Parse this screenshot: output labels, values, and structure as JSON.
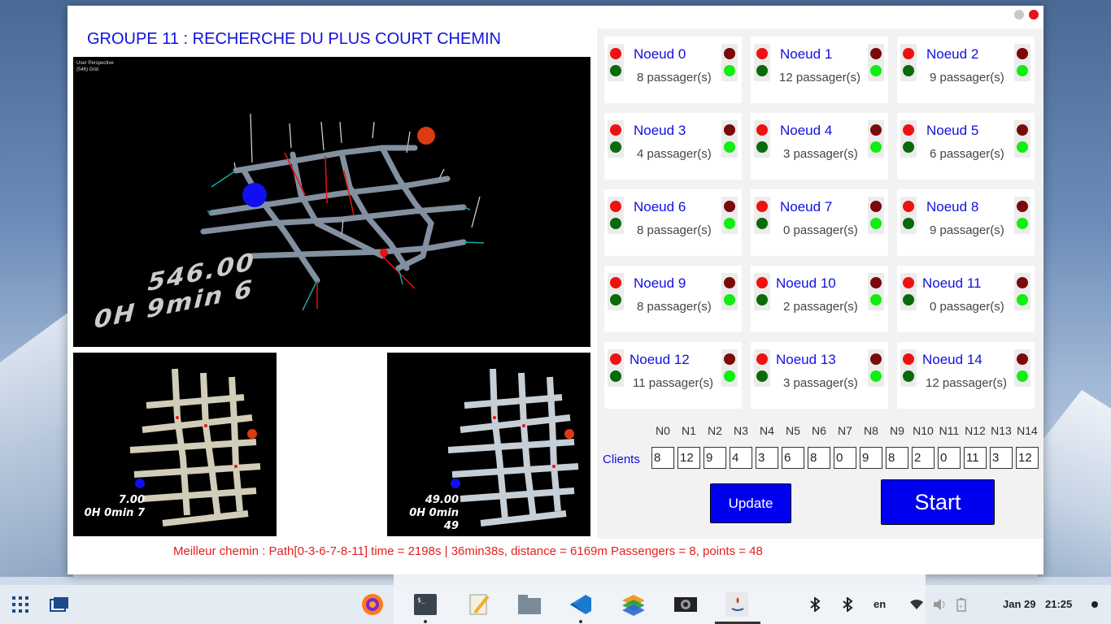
{
  "window": {
    "title": "GROUPE 11 : RECHERCHE DU PLUS COURT CHEMIN"
  },
  "viewports": {
    "main": {
      "caption_line1": "User Perspective",
      "caption_line2": "(546) Grid",
      "overlay_line1": "546.00",
      "overlay_line2": "0H 9min 6"
    },
    "left": {
      "overlay_line1": "7.00",
      "overlay_line2": "0H 0min 7"
    },
    "right": {
      "overlay_line1": "49.00",
      "overlay_line2": "0H 0min 49"
    }
  },
  "nodes": [
    {
      "name": "Noeud 0",
      "passengers": "8 passager(s)"
    },
    {
      "name": "Noeud 1",
      "passengers": "12 passager(s)"
    },
    {
      "name": "Noeud 2",
      "passengers": "9 passager(s)"
    },
    {
      "name": "Noeud 3",
      "passengers": "4 passager(s)"
    },
    {
      "name": "Noeud 4",
      "passengers": "3 passager(s)"
    },
    {
      "name": "Noeud 5",
      "passengers": "6 passager(s)"
    },
    {
      "name": "Noeud 6",
      "passengers": "8 passager(s)"
    },
    {
      "name": "Noeud 7",
      "passengers": "0 passager(s)"
    },
    {
      "name": "Noeud 8",
      "passengers": "9 passager(s)"
    },
    {
      "name": "Noeud 9",
      "passengers": "8 passager(s)"
    },
    {
      "name": "Noeud 10",
      "passengers": "2 passager(s)"
    },
    {
      "name": "Noeud 11",
      "passengers": "0 passager(s)"
    },
    {
      "name": "Noeud 12",
      "passengers": "11 passager(s)"
    },
    {
      "name": "Noeud 13",
      "passengers": "3 passager(s)"
    },
    {
      "name": "Noeud 14",
      "passengers": "12 passager(s)"
    }
  ],
  "status_colors": {
    "red": "#ee1111",
    "dark_green": "#0a6a0a",
    "dark_red": "#7a0a0a",
    "bright_green": "#11ee11"
  },
  "clients": {
    "label": "Clients",
    "headers": [
      "N0",
      "N1",
      "N2",
      "N3",
      "N4",
      "N5",
      "N6",
      "N7",
      "N8",
      "N9",
      "N10",
      "N11",
      "N12",
      "N13",
      "N14"
    ],
    "values": [
      "8",
      "12",
      "9",
      "4",
      "3",
      "6",
      "8",
      "0",
      "9",
      "8",
      "2",
      "0",
      "11",
      "3",
      "12"
    ]
  },
  "buttons": {
    "update": "Update",
    "start": "Start"
  },
  "result": "Meilleur chemin : Path[0-3-6-7-8-11] time = 2198s | 36min38s, distance = 6169m Passengers = 8, points = 48",
  "taskbar": {
    "apps": [
      "apps-grid-icon",
      "windows-icon",
      "firefox-icon",
      "terminal-icon",
      "text-editor-icon",
      "files-icon",
      "vscode-icon",
      "layers-app-icon",
      "screenshot-icon",
      "java-icon"
    ],
    "lang": "en",
    "date": "Jan 29",
    "time": "21:25"
  }
}
